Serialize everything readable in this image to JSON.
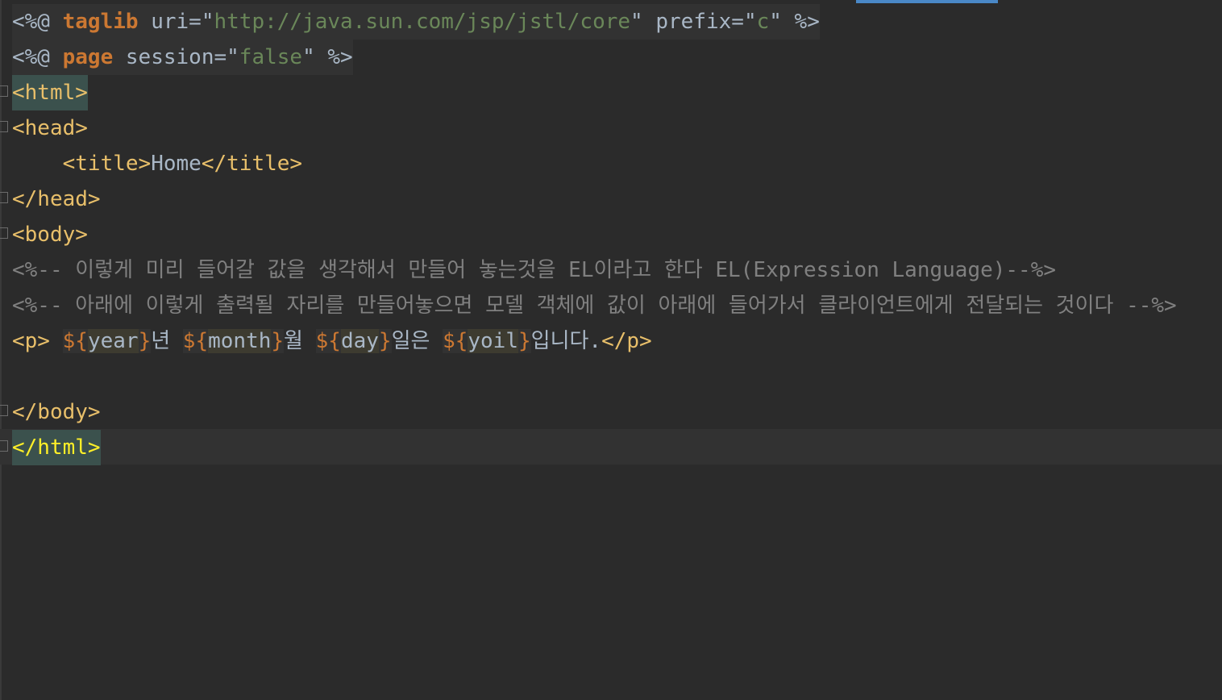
{
  "editor": {
    "language": "JSP",
    "lines": {
      "l1": {
        "open": "<%@ ",
        "kw": "taglib",
        "attr1": " uri=",
        "q1": "\"",
        "uri": "http://java.sun.com/jsp/jstl/core",
        "q2": "\"",
        "attr2": " prefix=",
        "q3": "\"",
        "prefix": "c",
        "q4": "\"",
        "close": " %>"
      },
      "l2": {
        "open": "<%@ ",
        "kw": "page",
        "attr1": " session=",
        "q1": "\"",
        "session": "false",
        "q2": "\"",
        "close": " %>"
      },
      "l3": {
        "tag": "<html>"
      },
      "l4": {
        "tag": "<head>"
      },
      "l5": {
        "indent": "    ",
        "open": "<title>",
        "text": "Home",
        "close": "</title>"
      },
      "l6": {
        "tag": "</head>"
      },
      "l7": {
        "tag": "<body>"
      },
      "l8": {
        "comment": "<%-- 이렇게 미리 들어갈 값을 생각해서 만들어 놓는것을 EL이라고 한다 EL(Expression Language)--%>"
      },
      "l9": {
        "comment": "<%-- 아래에 이렇게 출력될 자리를 만들어놓으면 모델 객체에 값이 아래에 들어가서 클라이언트에게 전달되는 것이다 --%>"
      },
      "l10": {
        "p_open": "<p>",
        "sp": " ",
        "el1_open": "${",
        "el1_var": "year",
        "el1_close": "}",
        "t1": "년 ",
        "el2_open": "${",
        "el2_var": "month",
        "el2_close": "}",
        "t2": "월 ",
        "el3_open": "${",
        "el3_var": "day",
        "el3_close": "}",
        "t3": "일은 ",
        "el4_open": "${",
        "el4_var": "yoil",
        "el4_close": "}",
        "t4": "입니다.",
        "p_close": "</p>"
      },
      "l12": {
        "tag": "</body>"
      },
      "l13": {
        "tag": "</html>"
      }
    }
  },
  "colors": {
    "background": "#2b2b2b",
    "tag": "#e8bf6a",
    "keyword": "#cc7832",
    "string": "#6a8759",
    "comment": "#808080",
    "text": "#a9b7c6",
    "matched_tag": "#ffef28",
    "tab_indicator": "#4a88c7"
  }
}
